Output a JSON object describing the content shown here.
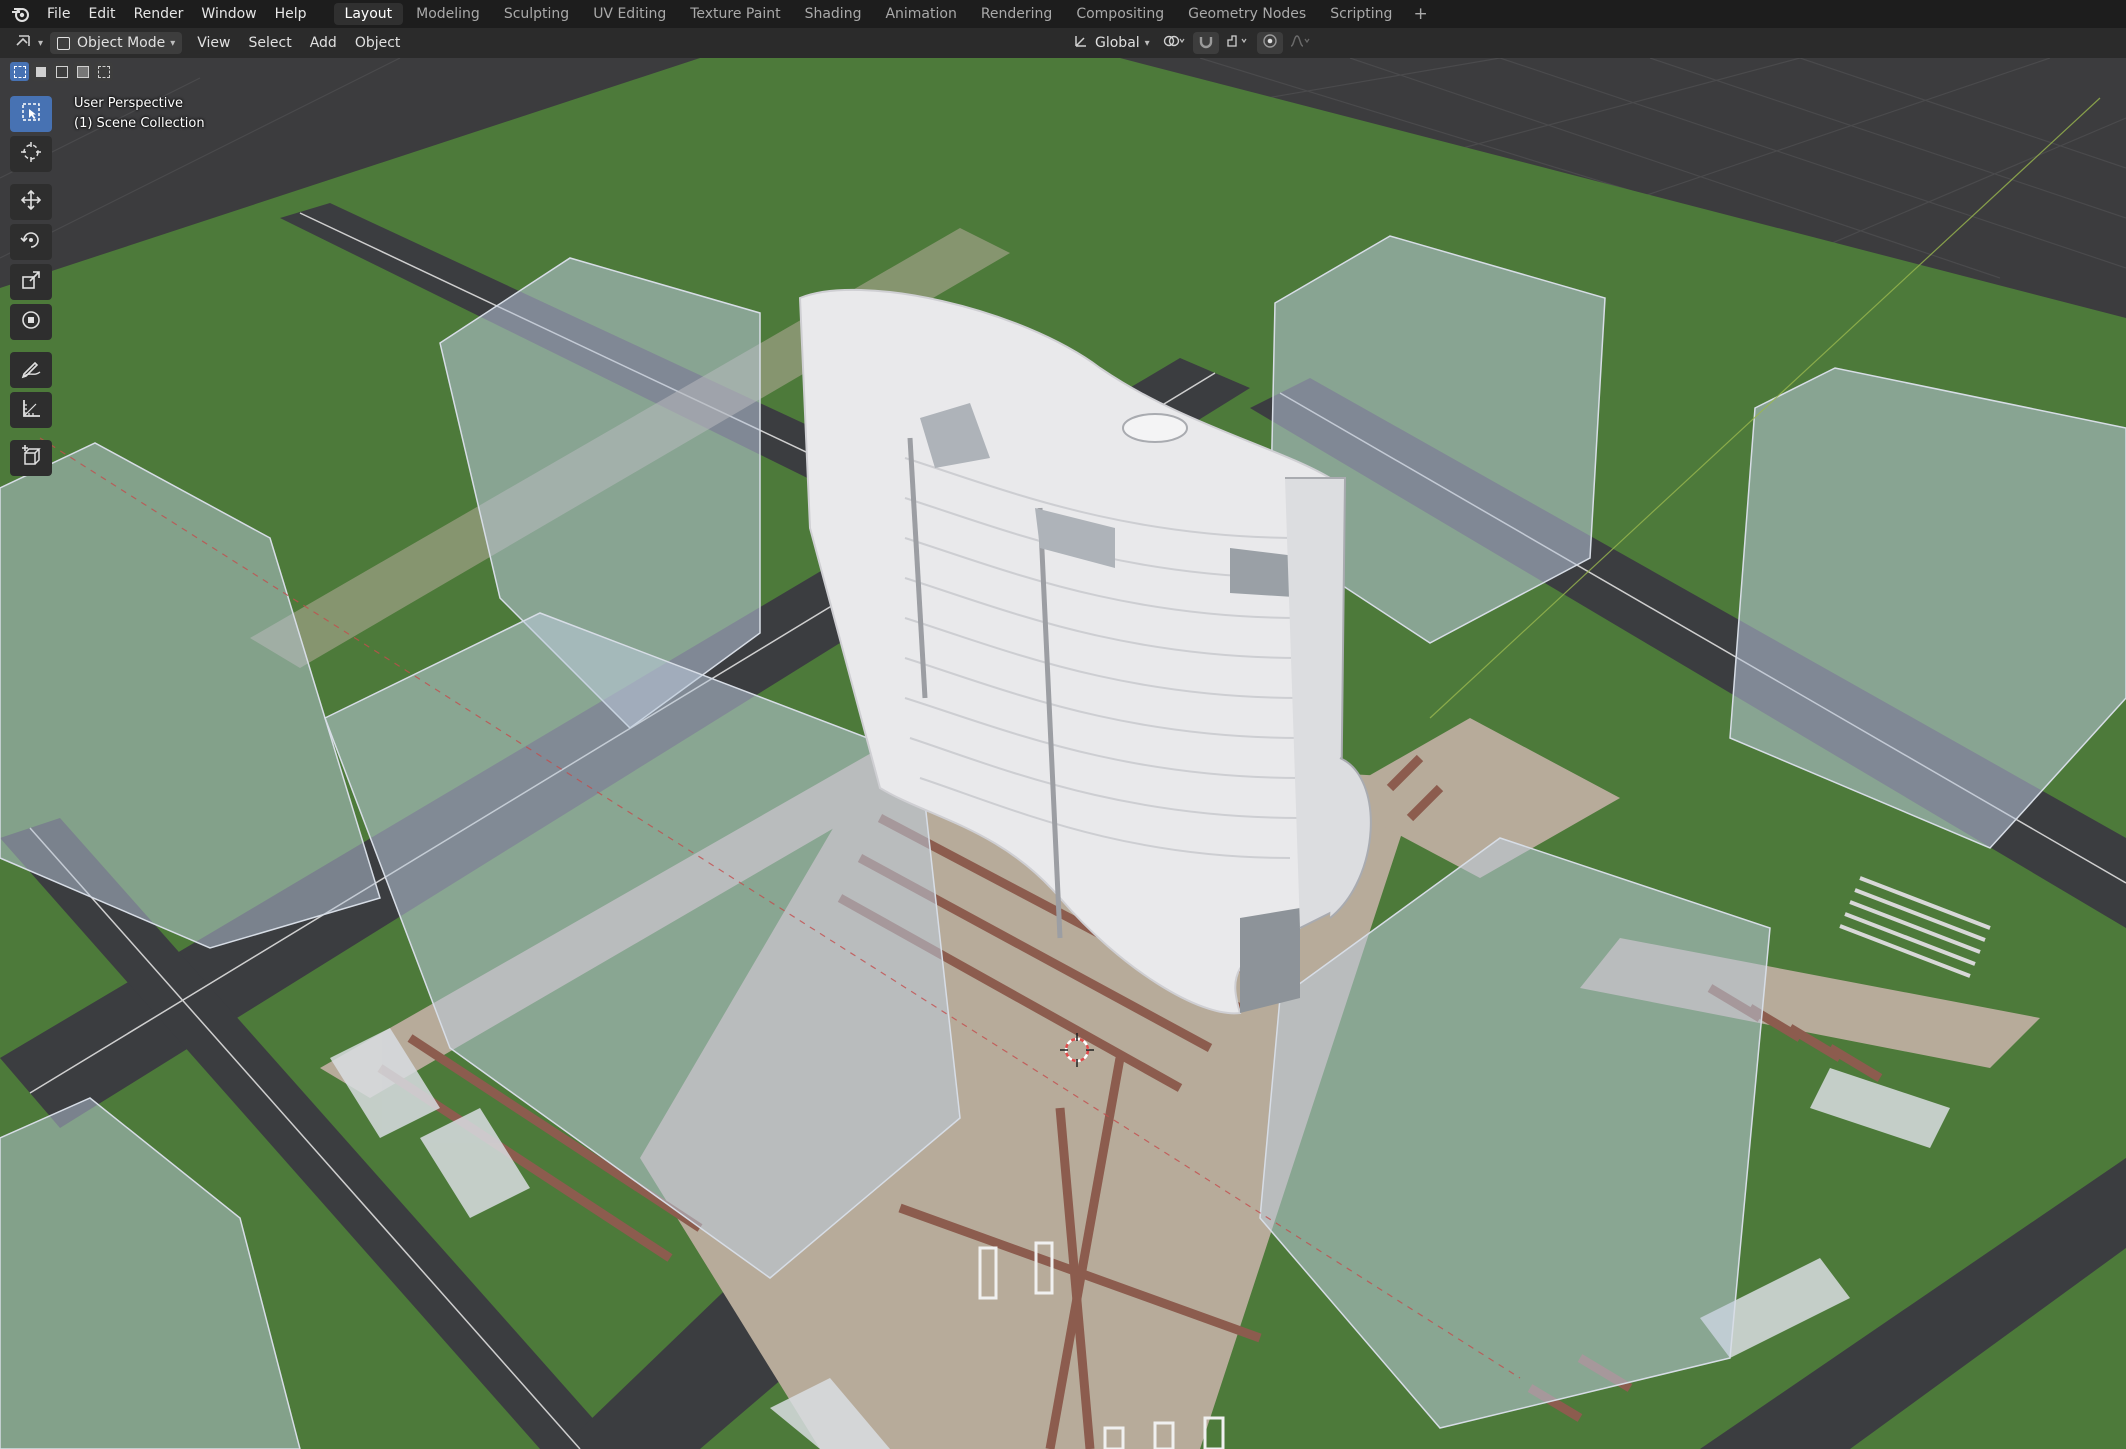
{
  "topbar": {
    "menus": [
      "File",
      "Edit",
      "Render",
      "Window",
      "Help"
    ],
    "workspaces": [
      "Layout",
      "Modeling",
      "Sculpting",
      "UV Editing",
      "Texture Paint",
      "Shading",
      "Animation",
      "Rendering",
      "Compositing",
      "Geometry Nodes",
      "Scripting"
    ],
    "active_workspace": "Layout",
    "add_label": "+"
  },
  "header": {
    "mode_label": "Object Mode",
    "menus": [
      "View",
      "Select",
      "Add",
      "Object"
    ],
    "transform_orientation": "Global"
  },
  "viewport": {
    "view_label": "User Perspective",
    "collection_label": "(1) Scene Collection"
  },
  "toolbar": {
    "tools": [
      "select-box",
      "cursor",
      "move",
      "rotate",
      "scale",
      "transform",
      "annotate",
      "measure",
      "add-cube"
    ],
    "active_tool": "select-box"
  },
  "colors": {
    "accent": "#4772b3",
    "grass": "#4d7a3a",
    "road": "#3b3d40",
    "sidewalk": "#b7ab9a",
    "paving_stripe": "#8c5c4e",
    "tower": "#e9e9eb",
    "glass_box": "#b9c7da"
  }
}
